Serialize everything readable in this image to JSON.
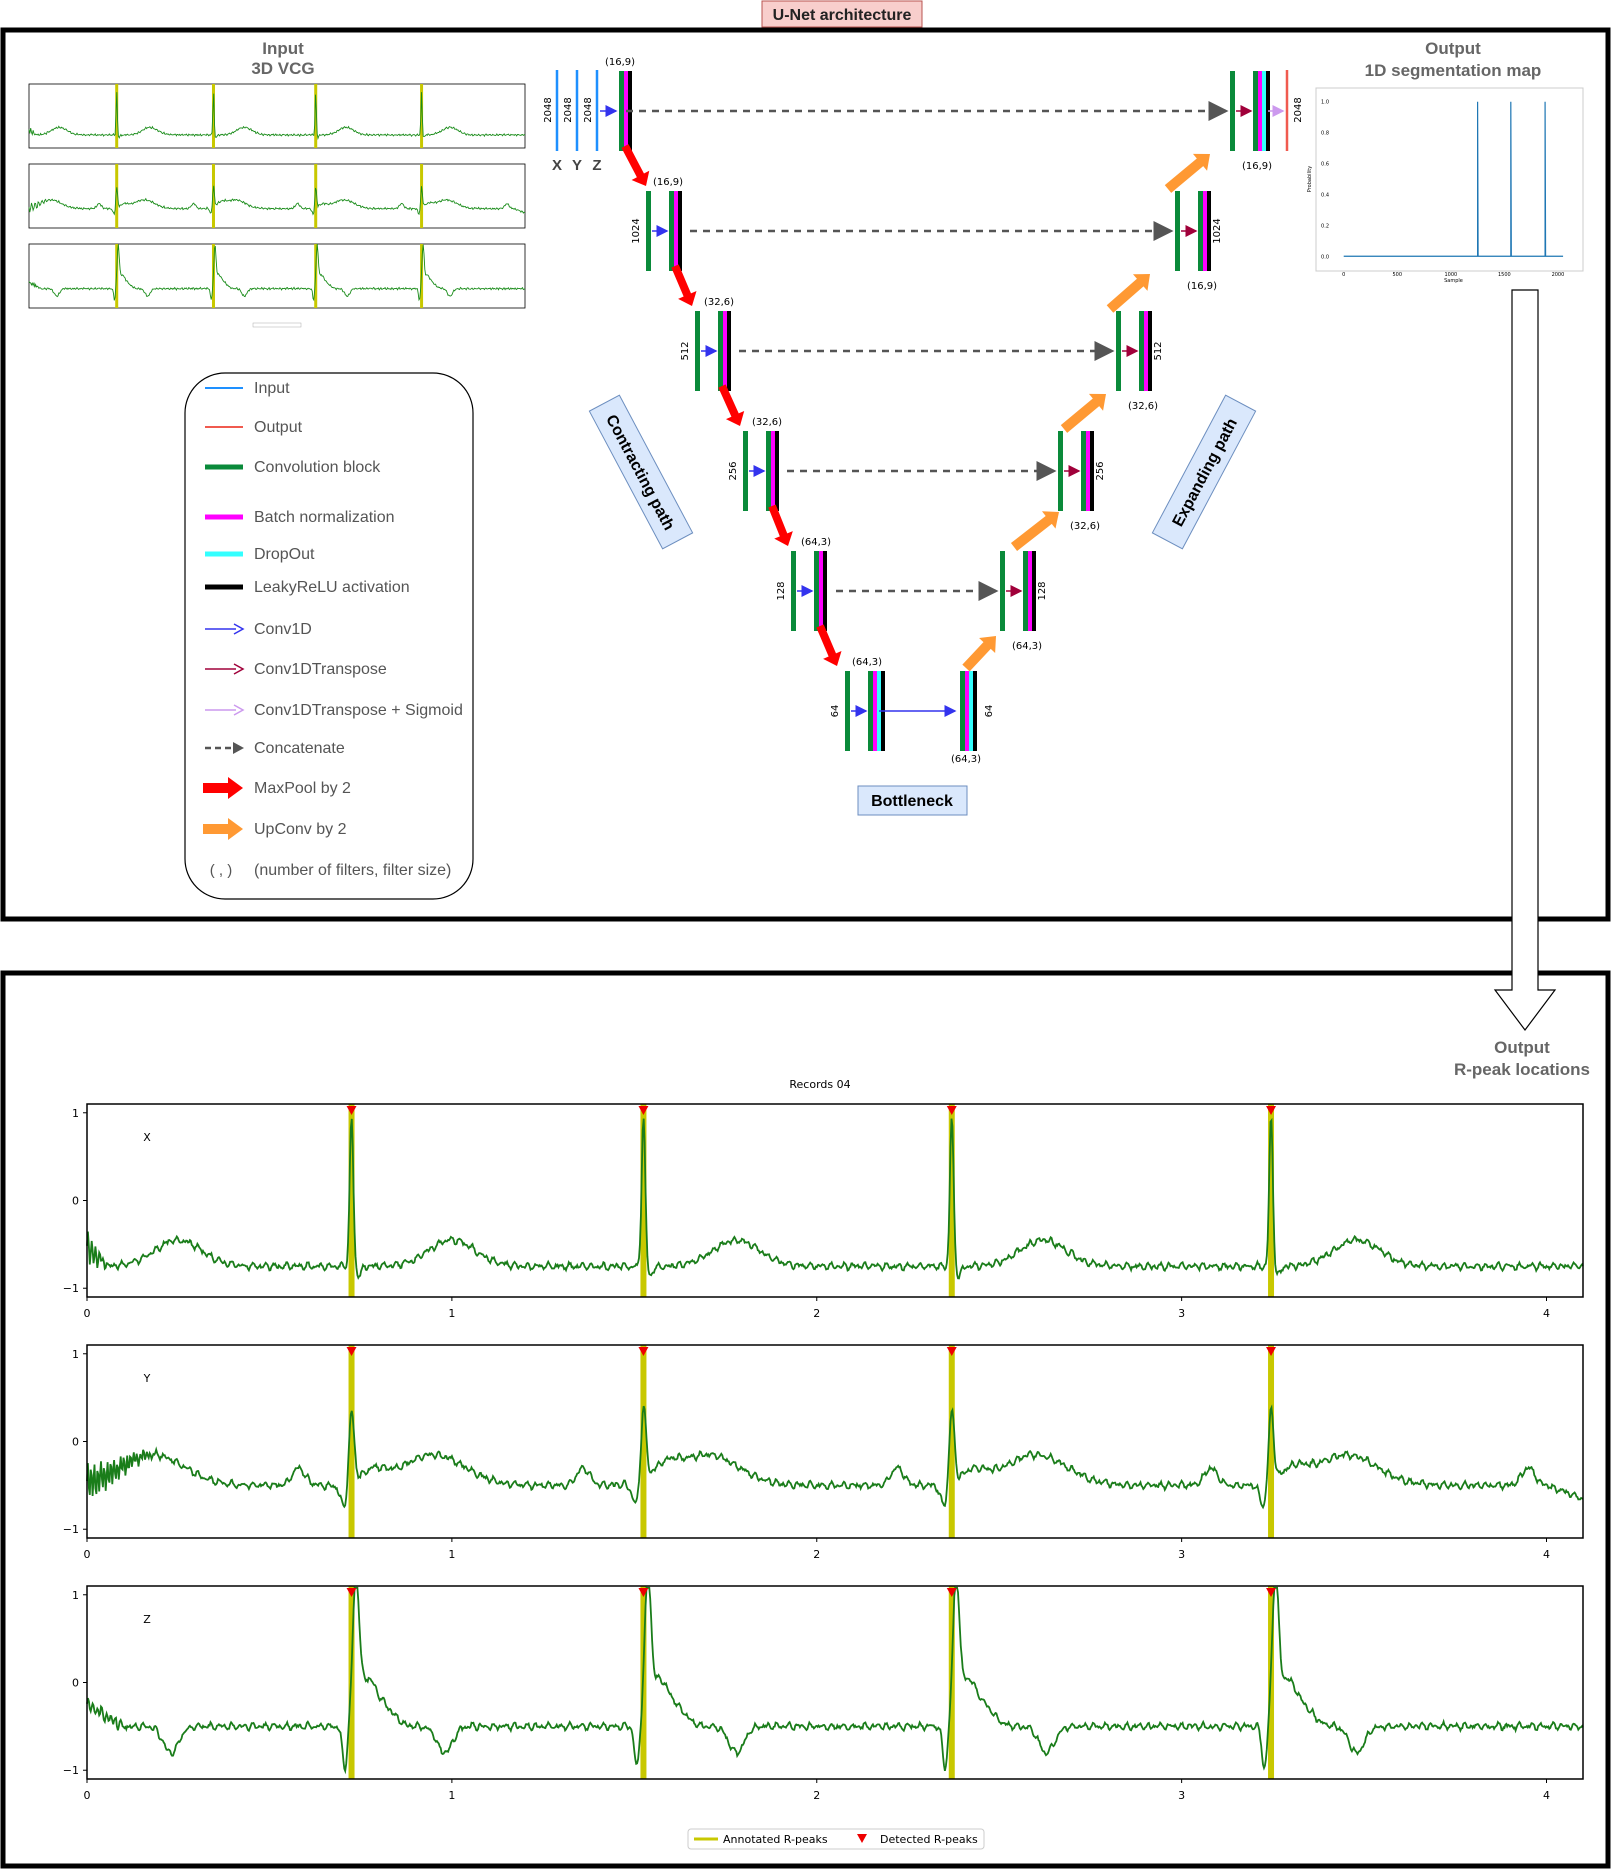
{
  "title": "U-Net architecture",
  "input": {
    "heading_line1": "Input",
    "heading_line2": "3D VCG"
  },
  "output_map": {
    "heading_line1": "Output",
    "heading_line2": "1D segmentation map",
    "yticks": [
      "0.0",
      "0.2",
      "0.4",
      "0.6",
      "0.8",
      "1.0"
    ],
    "xticks": [
      "0",
      "500",
      "1000",
      "1500",
      "2000"
    ],
    "xlabel": "Sample",
    "ylabel": "Probability",
    "peaks": [
      1250,
      1560,
      1880
    ]
  },
  "output_peaks": {
    "heading_line1": "Output",
    "heading_line2": "R-peak locations"
  },
  "unet": {
    "input_channels": [
      "X",
      "Y",
      "Z"
    ],
    "input_length": "2048",
    "output_length": "2048",
    "levels": [
      {
        "length": "2048",
        "enc_filter": "(16,9)",
        "dec_filter": "(16,9)"
      },
      {
        "length": "1024",
        "enc_filter": "(16,9)",
        "dec_filter": "(16,9)"
      },
      {
        "length": "512",
        "enc_filter": "(32,6)",
        "dec_filter": "(32,6)"
      },
      {
        "length": "256",
        "enc_filter": "(32,6)",
        "dec_filter": "(32,6)"
      },
      {
        "length": "128",
        "enc_filter": "(64,3)",
        "dec_filter": "(64,3)"
      },
      {
        "length": "64",
        "enc_filter": "(64,3)",
        "dec_filter": "(64,3)"
      }
    ],
    "contracting_label": "Contracting path",
    "expanding_label": "Expanding path",
    "bottleneck_label": "Bottleneck"
  },
  "legend": {
    "items": [
      {
        "label": "Input",
        "kind": "line",
        "color": "#1e90ff"
      },
      {
        "label": "Output",
        "kind": "line",
        "color": "#f05a4f"
      },
      {
        "label": "Convolution block",
        "kind": "thick",
        "color": "#0a8a3a"
      },
      {
        "label": "Batch normalization",
        "kind": "thick",
        "color": "#ff00ff"
      },
      {
        "label": "DropOut",
        "kind": "thick",
        "color": "#33ffff"
      },
      {
        "label": "LeakyReLU activation",
        "kind": "thick",
        "color": "#000000"
      },
      {
        "label": "Conv1D",
        "kind": "arrow",
        "color": "#3333ee"
      },
      {
        "label": "Conv1DTranspose",
        "kind": "arrow",
        "color": "#a0003a"
      },
      {
        "label": "Conv1DTranspose + Sigmoid",
        "kind": "arrow",
        "color": "#cc99ee"
      },
      {
        "label": "Concatenate",
        "kind": "dashed",
        "color": "#555555"
      },
      {
        "label": "MaxPool by 2",
        "kind": "bigarrow",
        "color": "#ff0000"
      },
      {
        "label": "UpConv by 2",
        "kind": "bigarrow",
        "color": "#ff9933"
      },
      {
        "label": "(number of filters, filter size)",
        "kind": "text",
        "symbol": "( , )"
      }
    ]
  },
  "chart_data": {
    "type": "line",
    "title": "Records 04",
    "xticks": [
      "0",
      "1",
      "2",
      "3",
      "4"
    ],
    "yticks": [
      "1",
      "0",
      "−1"
    ],
    "xlim": [
      0,
      4.1
    ],
    "ylim": [
      -1.1,
      1.1
    ],
    "r_peaks_annotated": [
      0.725,
      1.525,
      2.37,
      3.245
    ],
    "r_peaks_detected": [
      0.725,
      1.525,
      2.37,
      3.245
    ],
    "series": [
      {
        "name": "X",
        "peak_value": 0.95,
        "baseline": -0.75
      },
      {
        "name": "Y",
        "peak_value": 0.3,
        "baseline": -0.5
      },
      {
        "name": "Z",
        "peak_value": 0.95,
        "baseline": -0.5
      }
    ],
    "legend": {
      "annotated": "Annotated R-peaks",
      "detected": "Detected R-peaks",
      "placement": "bottom-center"
    }
  }
}
